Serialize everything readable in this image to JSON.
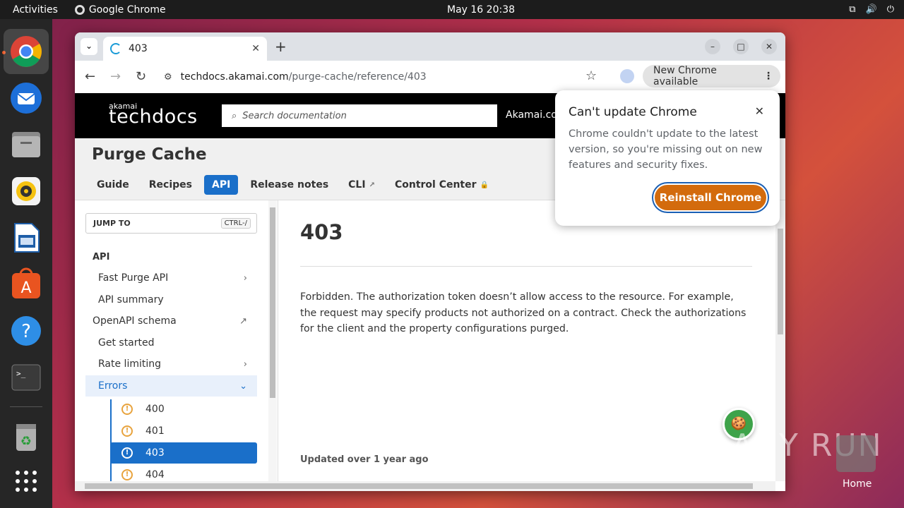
{
  "topbar": {
    "activities": "Activities",
    "app_name": "Google Chrome",
    "clock": "May 16  20:38",
    "tray_icons": [
      "network-icon",
      "volume-icon",
      "power-icon"
    ]
  },
  "dock": {
    "items": [
      "chrome-icon",
      "thunderbird-icon",
      "files-icon",
      "rhythmbox-icon",
      "writer-icon",
      "app-center-icon",
      "help-icon",
      "terminal-icon",
      "trash-icon",
      "app-grid-icon"
    ]
  },
  "browser": {
    "tab_title": "403",
    "url_host": "techdocs.akamai.com",
    "url_path": "/purge-cache/reference/403",
    "update_pill": "New Chrome available"
  },
  "site": {
    "logo_small": "akamai",
    "logo": "techdocs",
    "search_placeholder": "Search documentation",
    "header_link": "Akamai.com",
    "page_title": "Purge Cache",
    "tabs": [
      {
        "label": "Guide"
      },
      {
        "label": "Recipes"
      },
      {
        "label": "API"
      },
      {
        "label": "Release notes"
      },
      {
        "label": "CLI"
      },
      {
        "label": "Control Center"
      }
    ]
  },
  "sidebar": {
    "jump_label": "JUMP TO",
    "jump_kbd": "CTRL-/",
    "section": "API",
    "items": [
      {
        "label": "Fast Purge API"
      },
      {
        "label": "API summary"
      },
      {
        "label": "OpenAPI schema"
      },
      {
        "label": "Get started"
      },
      {
        "label": "Rate limiting"
      },
      {
        "label": "Errors"
      }
    ],
    "errors": [
      {
        "label": "400"
      },
      {
        "label": "401"
      },
      {
        "label": "403"
      },
      {
        "label": "404"
      }
    ]
  },
  "article": {
    "title": "403",
    "description": "Forbidden. The authorization token doesn’t allow access to the resource. For example, the request may specify products not authorized on a contract. Check the authorizations for the client and the property configurations purged.",
    "updated": "Updated over 1 year ago"
  },
  "popup": {
    "title": "Can't update Chrome",
    "body": "Chrome couldn't update to the latest version, so you're missing out on new features and security fixes.",
    "button": "Reinstall Chrome"
  },
  "desktop": {
    "watermark": "ANY RUN",
    "home_label": "Home"
  },
  "colors": {
    "accent": "#1a6fc9",
    "reinstall_button": "#d36b0d",
    "topbar": "#1c1c1c"
  }
}
